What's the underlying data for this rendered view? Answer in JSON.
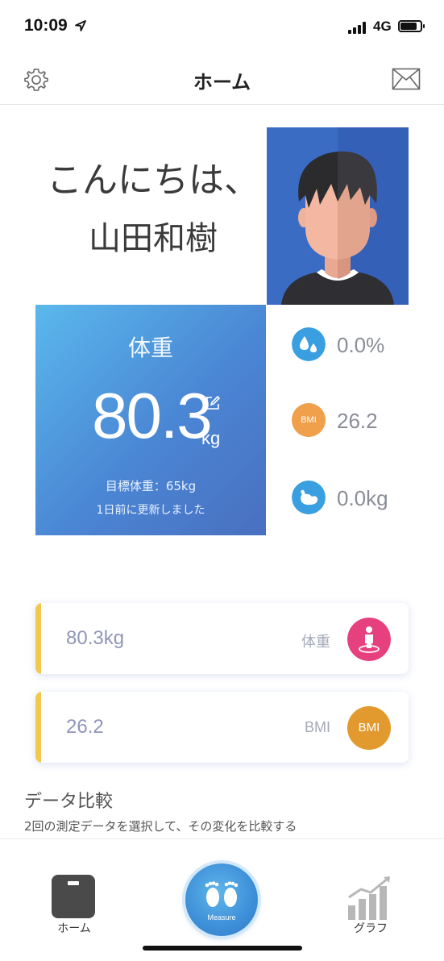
{
  "status_bar": {
    "time": "10:09",
    "network": "4G",
    "battery_level": 0.85
  },
  "nav": {
    "title": "ホーム",
    "settings_icon": "gear-icon",
    "mail_icon": "mail-icon"
  },
  "greeting": {
    "line1": "こんにちは、",
    "name": "山田和樹"
  },
  "weight_card": {
    "label": "体重",
    "value": "80.3",
    "unit": "kg",
    "target": "目標体重：65kg",
    "updated": "1日前に更新しました"
  },
  "metrics": [
    {
      "icon": "water-drop-icon",
      "value": "0.0%"
    },
    {
      "icon": "BMI",
      "value": "26.2"
    },
    {
      "icon": "muscle-icon",
      "value": "0.0kg"
    }
  ],
  "records": [
    {
      "value": "80.3kg",
      "label": "体重",
      "icon": "person-scale-icon"
    },
    {
      "value": "26.2",
      "label": "BMI",
      "icon": "BMI"
    }
  ],
  "compare": {
    "title": "データ比較",
    "description": "2回の測定データを選択して、その変化を比較する"
  },
  "tab_bar": {
    "home_label": "ホーム",
    "measure_label": "Measure",
    "graph_label": "グラフ"
  },
  "colors": {
    "accent_blue": "#4a86d4",
    "bmi_orange": "#f0a04a",
    "pink": "#e6407e",
    "card_stripe": "#f2c94c"
  }
}
